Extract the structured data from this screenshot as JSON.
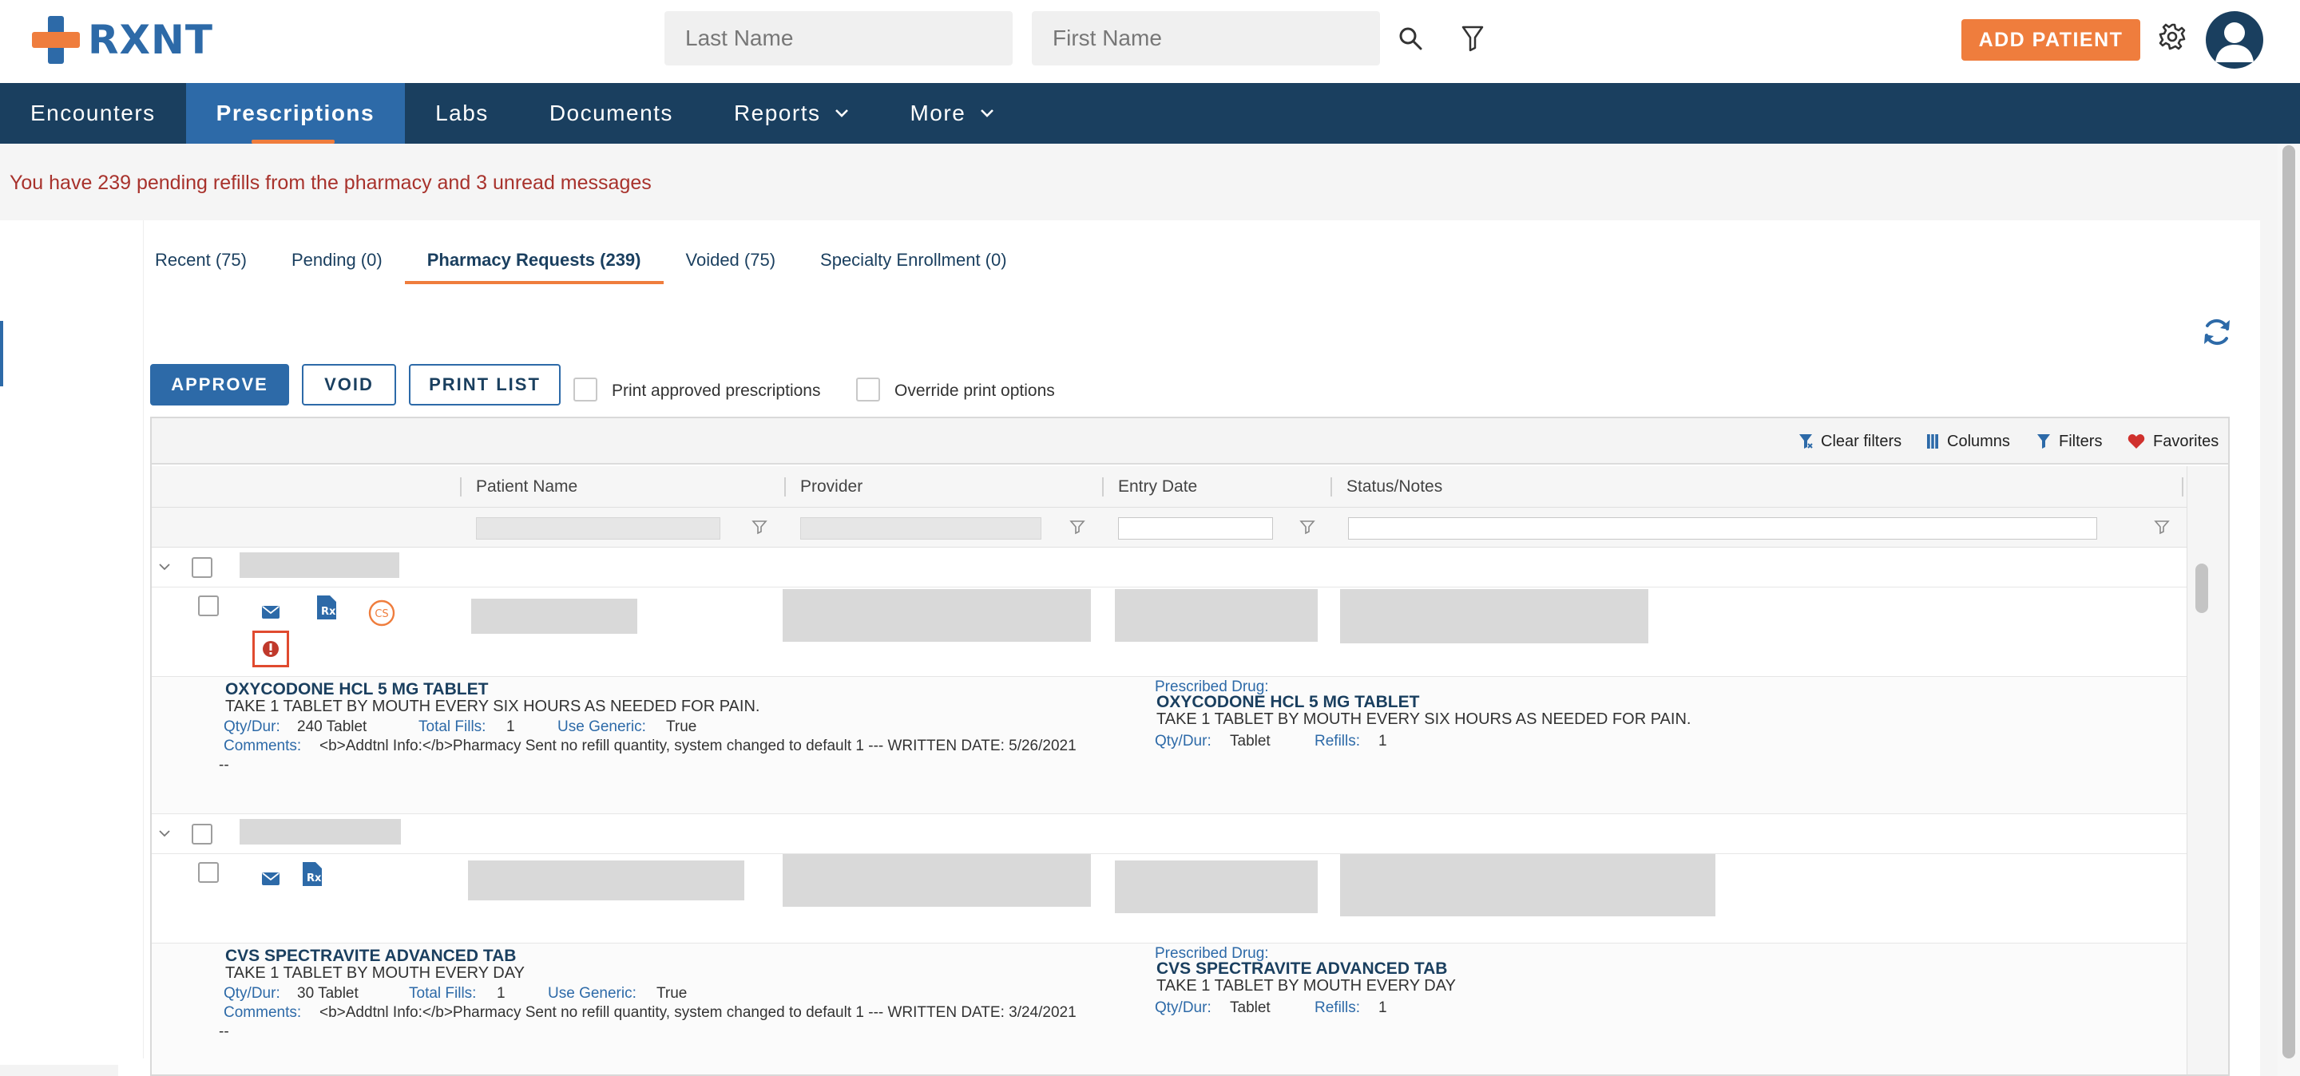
{
  "header": {
    "logo_text": "RXNT",
    "last_name_placeholder": "Last Name",
    "first_name_placeholder": "First Name",
    "add_patient_label": "ADD PATIENT"
  },
  "nav": {
    "items": [
      {
        "label": "Encounters"
      },
      {
        "label": "Prescriptions"
      },
      {
        "label": "Labs"
      },
      {
        "label": "Documents"
      },
      {
        "label": "Reports"
      },
      {
        "label": "More"
      }
    ]
  },
  "alert": {
    "text": "You have 239 pending refills from the pharmacy  and 3 unread messages"
  },
  "tabs": [
    {
      "label": "Recent (75)"
    },
    {
      "label": "Pending (0)"
    },
    {
      "label": "Pharmacy Requests (239)"
    },
    {
      "label": "Voided (75)"
    },
    {
      "label": "Specialty Enrollment (0)"
    }
  ],
  "actions": {
    "approve": "APPROVE",
    "void": "VOID",
    "print_list": "PRINT LIST",
    "print_approved": "Print approved prescriptions",
    "override_print": "Override print options"
  },
  "grid_toolbar": {
    "clear_filters": "Clear filters",
    "columns": "Columns",
    "filters": "Filters",
    "favorites": "Favorites"
  },
  "columns": {
    "patient_name": "Patient Name",
    "provider": "Provider",
    "entry_date": "Entry Date",
    "status_notes": "Status/Notes"
  },
  "records": [
    {
      "requested_drug": "OXYCODONE HCL 5 MG TABLET",
      "requested_sig": "TAKE 1 TABLET BY MOUTH EVERY SIX HOURS AS NEEDED FOR PAIN.",
      "qty_label": "Qty/Dur:",
      "qty": "240 Tablet",
      "total_fills_label": "Total Fills:",
      "total_fills": "1",
      "use_generic_label": "Use Generic:",
      "use_generic": "True",
      "comments_label": "Comments:",
      "comments": "<b>Addtnl Info:</b>Pharmacy Sent no refill quantity, system changed to default 1 --- WRITTEN DATE: 5/26/2021",
      "comments_tail": "--",
      "prescribed_label": "Prescribed Drug:",
      "prescribed_drug": "OXYCODONE HCL 5 MG TABLET",
      "prescribed_sig": "TAKE 1 TABLET BY MOUTH EVERY SIX HOURS AS NEEDED FOR PAIN.",
      "p_qty_label": "Qty/Dur:",
      "p_qty": "Tablet",
      "refills_label": "Refills:",
      "refills": "1",
      "cs_badge": "CS"
    },
    {
      "requested_drug": "CVS SPECTRAVITE ADVANCED TAB",
      "requested_sig": "TAKE 1 TABLET BY MOUTH EVERY DAY",
      "qty_label": "Qty/Dur:",
      "qty": "30 Tablet",
      "total_fills_label": "Total Fills:",
      "total_fills": "1",
      "use_generic_label": "Use Generic:",
      "use_generic": "True",
      "comments_label": "Comments:",
      "comments": "<b>Addtnl Info:</b>Pharmacy Sent no refill quantity, system changed to default 1 --- WRITTEN DATE: 3/24/2021",
      "comments_tail": "--",
      "prescribed_label": "Prescribed Drug:",
      "prescribed_drug": "CVS SPECTRAVITE ADVANCED TAB",
      "prescribed_sig": "TAKE 1 TABLET BY MOUTH EVERY DAY",
      "p_qty_label": "Qty/Dur:",
      "p_qty": "Tablet",
      "refills_label": "Refills:",
      "refills": "1"
    }
  ],
  "colors": {
    "brand_blue": "#2d6aa8",
    "nav_dark": "#1a3f5f",
    "accent_orange": "#ef7d3d",
    "alert_red": "#a8322c"
  }
}
